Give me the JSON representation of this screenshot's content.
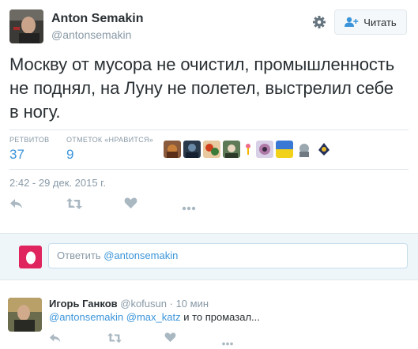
{
  "tweet": {
    "author_name": "Anton Semakin",
    "author_handle": "@antonsemakin",
    "follow_label": "Читать",
    "text": "Москву от мусора не очистил, промышленность не поднял, на Луну не полетел, выстрелил себе в ногу.",
    "retweets_label": "РЕТВИТОВ",
    "retweets_count": "37",
    "likes_label": "ОТМЕТОК «НРАВИТСЯ»",
    "likes_count": "9",
    "timestamp": "2:42 - 29 дек. 2015 г."
  },
  "reply_box": {
    "prefix": "Ответить",
    "mention": "@antonsemakin"
  },
  "reply": {
    "author_name": "Игорь Ганков",
    "author_handle": "@kofusun",
    "separator": "·",
    "time": "10 мин",
    "mention_1": "@antonsemakin",
    "mention_2": "@max_katz",
    "text_rest": "и то промазал..."
  },
  "colors": {
    "link": "#3b94d9",
    "muted": "#8899a6",
    "text": "#292f33",
    "reply_bg": "#eef6fa",
    "egg": "#e0245e"
  },
  "icons": [
    "gear-icon",
    "add-user-icon",
    "reply-icon",
    "retweet-icon",
    "heart-icon",
    "more-icon",
    "egg-icon"
  ]
}
